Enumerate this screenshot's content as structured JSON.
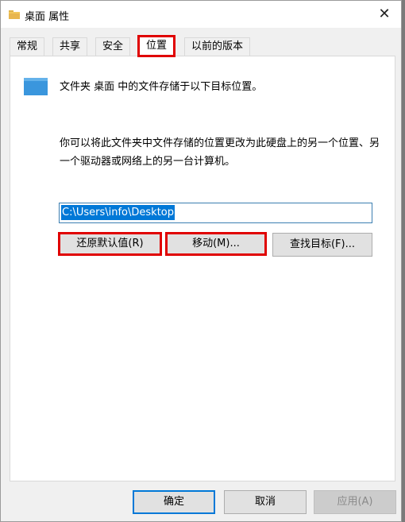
{
  "window": {
    "title": "桌面 属性",
    "close_glyph": "✕"
  },
  "tabs": [
    {
      "label": "常规",
      "active": false
    },
    {
      "label": "共享",
      "active": false
    },
    {
      "label": "安全",
      "active": false
    },
    {
      "label": "位置",
      "active": true
    },
    {
      "label": "以前的版本",
      "active": false
    }
  ],
  "location": {
    "heading": "文件夹 桌面 中的文件存储于以下目标位置。",
    "description": "你可以将此文件夹中文件存储的位置更改为此硬盘上的另一个位置、另一个驱动器或网络上的另一台计算机。",
    "path_value": "C:\\Users\\info\\Desktop",
    "restore_default_label": "还原默认值(R)",
    "move_label": "移动(M)...",
    "find_target_label": "查找目标(F)..."
  },
  "footer": {
    "ok_label": "确定",
    "cancel_label": "取消",
    "apply_label": "应用(A)"
  },
  "colors": {
    "highlight_border": "#e00000",
    "selection": "#0078d7",
    "folder_blue": "#3a96dd"
  }
}
